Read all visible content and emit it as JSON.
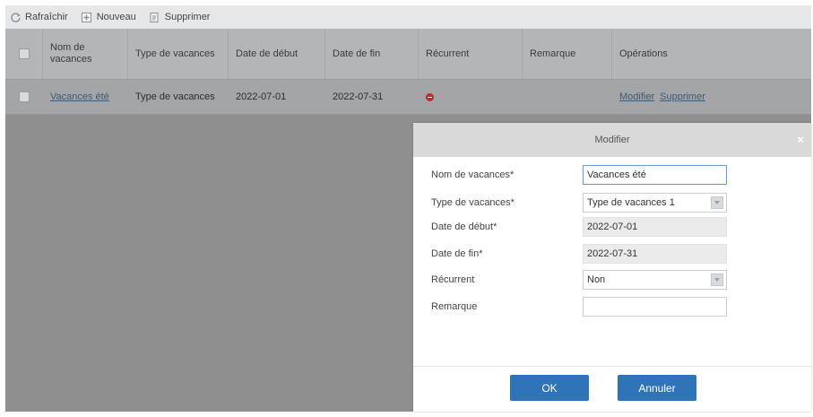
{
  "toolbar": {
    "refresh_label": "Rafraîchir",
    "new_label": "Nouveau",
    "delete_label": "Supprimer"
  },
  "grid": {
    "columns": [
      "Nom de vacances",
      "Type de vacances",
      "Date de début",
      "Date de fin",
      "Récurrent",
      "Remarque",
      "Opérations"
    ],
    "rows": [
      {
        "name": "Vacances été",
        "type": "Type de vacances",
        "start": "2022-07-01",
        "end": "2022-07-31",
        "recurrent_icon": "red-minus-circle-icon",
        "remark": "",
        "op_edit": "Modifier",
        "op_delete": "Supprimer"
      }
    ]
  },
  "dialog": {
    "title": "Modifier",
    "close_glyph": "×",
    "fields": {
      "name_label": "Nom de vacances*",
      "name_value": "Vacances été",
      "type_label": "Type de vacances*",
      "type_value": "Type de vacances 1",
      "start_label": "Date de début*",
      "start_value": "2022-07-01",
      "end_label": "Date de fin*",
      "end_value": "2022-07-31",
      "recurrent_label": "Récurrent",
      "recurrent_value": "Non",
      "remark_label": "Remarque",
      "remark_value": ""
    },
    "ok_label": "OK",
    "cancel_label": "Annuler"
  },
  "colors": {
    "accent": "#2f73b9",
    "overlay": "#8f8f8f",
    "recurrent_icon": "#c0292d"
  }
}
